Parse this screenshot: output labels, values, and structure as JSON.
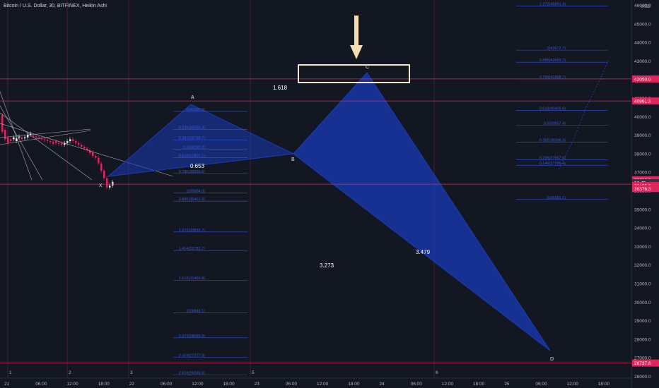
{
  "title": "Bitcoin / U.S. Dollar, 30, BITFINEX, Heikin Ashi",
  "currency": "USD",
  "colors": {
    "background": "#131722",
    "pattern_fill": "#1a3bb8",
    "fib_line": "#2b52e6",
    "fib_text": "#3a5ad8",
    "hline": "#e0245e",
    "vline": "#7a2a4a",
    "candle_up": "#e8e8e8",
    "candle_down": "#e0245e",
    "highlight_box": "#f5e6c8",
    "arrow": "#f5deb3"
  },
  "chart_data": {
    "type": "candlestick",
    "series": [
      {
        "name": "Heikin Ashi"
      }
    ],
    "ylim": [
      26000,
      46000
    ],
    "y_ticks": [
      26000,
      27000,
      28000,
      29000,
      30000,
      31000,
      32000,
      33000,
      34000,
      35000,
      36000,
      37000,
      38000,
      39000,
      40000,
      41000,
      42000,
      43000,
      44000,
      45000,
      46000
    ],
    "x_tick_labels": [
      "21",
      "06:00",
      "12:00",
      "18:00",
      "22",
      "06:00",
      "12:00",
      "18:00",
      "23",
      "06:00",
      "12:00",
      "18:00",
      "24",
      "06:00",
      "12:00",
      "18:00",
      "25",
      "06:00",
      "12:00",
      "18:00"
    ],
    "day_markers": [
      "1",
      "2",
      "3",
      "5",
      "6"
    ],
    "pattern_points": [
      {
        "label": "X",
        "x": 0,
        "y": 35900
      },
      {
        "label": "A",
        "x": 1,
        "y": 40300
      },
      {
        "label": "B",
        "x": 2,
        "y": 37800
      },
      {
        "label": "C",
        "x": 3,
        "y": 42000
      },
      {
        "label": "D",
        "x": 4,
        "y": 26900
      }
    ],
    "ratios": [
      {
        "text": "0.653"
      },
      {
        "text": "1.618"
      },
      {
        "text": "3.273"
      },
      {
        "text": "3.479"
      }
    ],
    "price_tags": [
      {
        "text": "42050.0",
        "value": 42050
      },
      {
        "text": "40861.3",
        "value": 40861
      },
      {
        "text": "36613.0",
        "value": 36613
      },
      {
        "text": "16:45",
        "value": 36455
      },
      {
        "text": "36435.0",
        "value": 36300
      },
      {
        "text": "36376.3",
        "value": 36140
      },
      {
        "text": "26737.6",
        "value": 26737
      }
    ],
    "hlines": [
      42050,
      40861,
      36376,
      26737
    ],
    "fib_left": [
      {
        "text": "0(40300.0)",
        "value": 40300
      },
      {
        "text": "0.236(39350.3)",
        "value": 39330
      },
      {
        "text": "0.382(38758.7)",
        "value": 38750
      },
      {
        "text": "0.5(38280.2)",
        "value": 38270
      },
      {
        "text": "0.618(37802.1)",
        "value": 37800
      },
      {
        "text": "0.786(36959.6)",
        "value": 36960
      },
      {
        "text": "0.886(35462.0)",
        "value": 35460
      },
      {
        "text": "1(35904.0)",
        "value": 35904
      },
      {
        "text": "1.272(33892.7)",
        "value": 33800
      },
      {
        "text": "1.414(32781.7)",
        "value": 32800
      },
      {
        "text": "1.618(31466.8)",
        "value": 31200
      },
      {
        "text": "2(29848.1)",
        "value": 29450
      },
      {
        "text": "2.272(28093.2)",
        "value": 28100
      },
      {
        "text": "2.414(27277.3)",
        "value": 27050
      },
      {
        "text": "2.618(26035.8)",
        "value": 26100
      }
    ],
    "fib_right": [
      {
        "text": "1.272(45891.4)",
        "value": 45980
      },
      {
        "text": "1(43672.7)",
        "value": 43600
      },
      {
        "text": "0.886(42683.7)",
        "value": 42950
      },
      {
        "text": "0.786(41808.7)",
        "value": 42050
      },
      {
        "text": "0.618(40409.9)",
        "value": 40350
      },
      {
        "text": "0.5(39657.4)",
        "value": 39550
      },
      {
        "text": "0.382(38396.3)",
        "value": 38650
      },
      {
        "text": "0.236(37657.6)",
        "value": 37700
      },
      {
        "text": "0.146(37286.4)",
        "value": 37400
      },
      {
        "text": "0(35681.1)",
        "value": 35550
      }
    ]
  }
}
